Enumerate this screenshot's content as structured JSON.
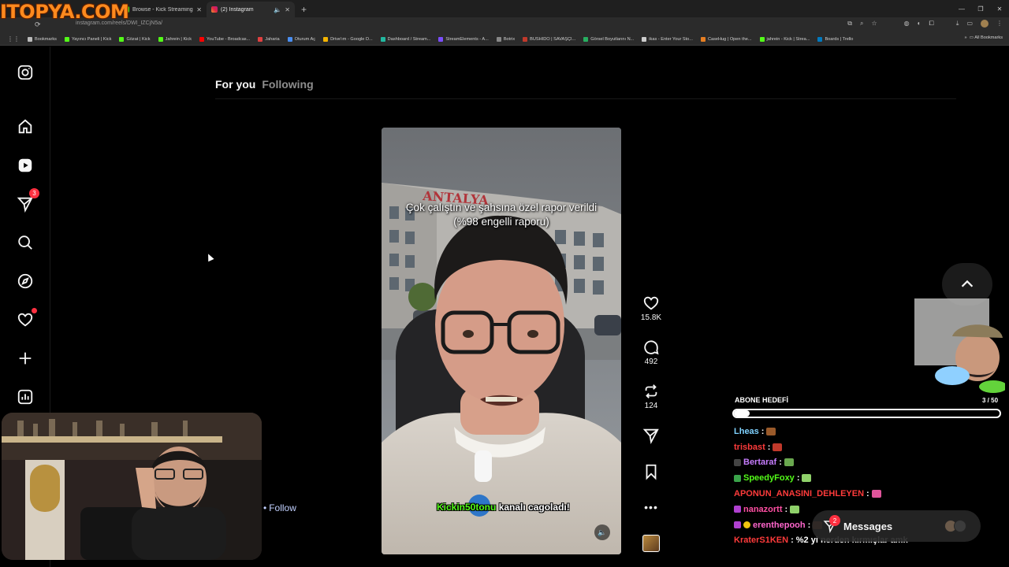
{
  "watermark": "ITOPYA.COM",
  "browser": {
    "tabs": [
      {
        "title": "Browse - Kick Streaming",
        "active": false
      },
      {
        "title": "(2) Instagram",
        "active": true
      }
    ],
    "new_tab": "+",
    "url": "instagram.com/reels/DWI_IZCjN5a/",
    "bookmarks": [
      {
        "label": "Bookmarks",
        "color": "#bbbbbb"
      },
      {
        "label": "Yayıncı Paneli | Kick",
        "color": "#53fc18"
      },
      {
        "label": "Gözat | Kick",
        "color": "#53fc18"
      },
      {
        "label": "Jahrein | Kick",
        "color": "#53fc18"
      },
      {
        "label": "YouTube - Broadcas...",
        "color": "#ff0000"
      },
      {
        "label": "Jaharia",
        "color": "#e04040"
      },
      {
        "label": "Oturum Aç",
        "color": "#4a8ef0"
      },
      {
        "label": "Drive'ım - Google D...",
        "color": "#f4b400"
      },
      {
        "label": "Dashboard / Stream...",
        "color": "#22b8a0"
      },
      {
        "label": "StreamElements - A...",
        "color": "#7b4dff"
      },
      {
        "label": "Botrix",
        "color": "#888888"
      },
      {
        "label": "BUSHIDO | SAVAŞÇI...",
        "color": "#c0392b"
      },
      {
        "label": "Görsel Boyutlarını N...",
        "color": "#27ae60"
      },
      {
        "label": "ikas - Enter Your Sto...",
        "color": "#cccccc"
      },
      {
        "label": "CaseHug | Open the...",
        "color": "#e67e22"
      },
      {
        "label": "jahrein - Kick | Strea...",
        "color": "#53fc18"
      },
      {
        "label": "Boards | Trello",
        "color": "#0079bf"
      }
    ],
    "all_bookmarks": "All Bookmarks"
  },
  "instagram": {
    "sidebar": [
      {
        "name": "instagram-logo-icon"
      },
      {
        "name": "home-icon"
      },
      {
        "name": "reels-icon"
      },
      {
        "name": "direct-messages-icon",
        "badge": "3"
      },
      {
        "name": "search-icon"
      },
      {
        "name": "explore-icon"
      },
      {
        "name": "notifications-icon"
      },
      {
        "name": "create-icon"
      },
      {
        "name": "dashboard-icon"
      }
    ],
    "feed_tabs": {
      "active": "For you",
      "inactive": "Following"
    },
    "reel": {
      "caption_line1": "Çok çalıştın ve şahsına özel rapor verildi",
      "caption_line2": "(%98 engelli raporu)",
      "sign_text": "ANTALYA"
    },
    "actions": {
      "likes": "15.8K",
      "comments": "492",
      "reposts": "124"
    },
    "follow_label": "Follow",
    "messages": {
      "label": "Messages",
      "badge": "2"
    }
  },
  "stream_overlay": {
    "ticker_highlight": "Kickin50tonu",
    "ticker_rest": " kanalı cagoladı!",
    "goal": {
      "label": "ABONE HEDEFİ",
      "count": "3 / 50",
      "progress": 0.06
    },
    "chat": [
      {
        "user": "Lheas",
        "color": "#7fd2ff",
        "msg": "",
        "emote": "#9a5a2a"
      },
      {
        "user": "trisbast",
        "color": "#ff3b3b",
        "msg": "",
        "emote": "#c0392b"
      },
      {
        "user": "Bertaraf",
        "color": "#c77dff",
        "msg": "",
        "emote": "#6aa84f",
        "badge": "#444444"
      },
      {
        "user": "SpeedyFoxy",
        "color": "#53fc18",
        "msg": "",
        "emote": "#8fd16a",
        "badge": "#3aa34a"
      },
      {
        "user": "APONUN_ANASINI_DEHLEYEN",
        "color": "#ff3b3b",
        "msg": "",
        "emote": "#e0559b"
      },
      {
        "user": "nanazortt",
        "color": "#ff4fa3",
        "msg": "",
        "emote": "#8fd16a",
        "badge": "#b040d0"
      },
      {
        "user": "erenthepooh",
        "color": "#ff66cc",
        "msg": "",
        "emote": "#a0522d",
        "badge": "#b040d0"
      },
      {
        "user": "KraterS1KEN",
        "color": "#ff3b3b",
        "msg": "%2 yi nerden kırmışlar amk"
      }
    ]
  },
  "colors": {
    "accent": "#0095f6",
    "badge_red": "#ff3040",
    "kick_green": "#53fc18"
  }
}
